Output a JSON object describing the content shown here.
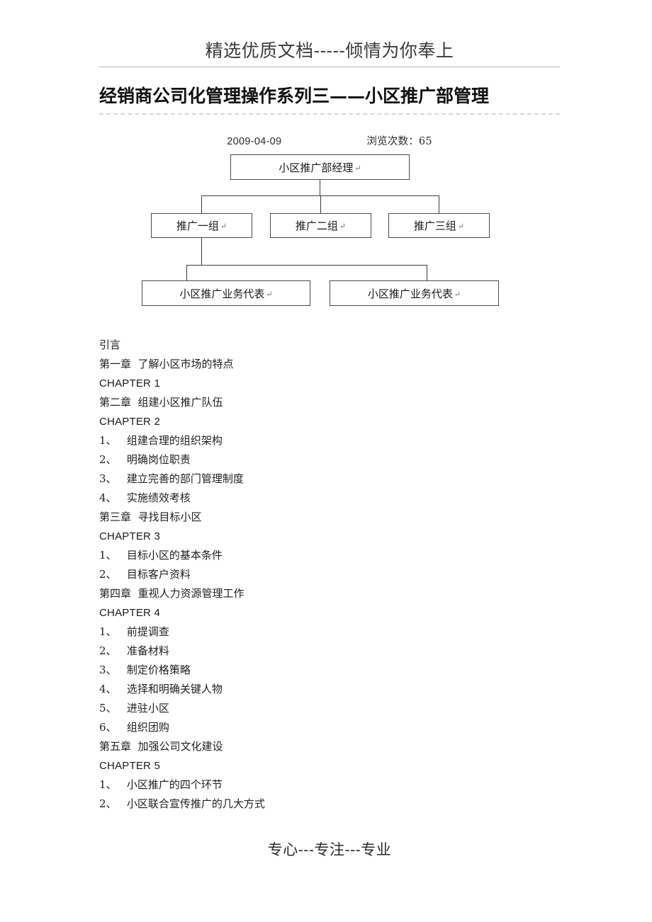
{
  "header": {
    "text": "精选优质文档-----倾情为你奉上"
  },
  "title": "经销商公司化管理操作系列三——小区推广部管理",
  "meta": {
    "date": "2009-04-09",
    "views_label": "浏览次数：65"
  },
  "org_chart": {
    "manager": {
      "label": "小区推广部经理",
      "mark": "↵"
    },
    "groups": [
      {
        "label": "推广一组",
        "mark": "↵"
      },
      {
        "label": "推广二组",
        "mark": "↵"
      },
      {
        "label": "推广三组",
        "mark": "↵"
      }
    ],
    "representatives": [
      {
        "label": "小区推广业务代表",
        "mark": "↵"
      },
      {
        "label": "小区推广业务代表",
        "mark": "↵"
      }
    ]
  },
  "toc": {
    "lines": [
      {
        "text": "引言",
        "style": "cjk"
      },
      {
        "text": "第一章  了解小区市场的特点",
        "style": "cjk"
      },
      {
        "text": "CHAPTER 1",
        "style": "latin"
      },
      {
        "text": "第二章  组建小区推广队伍",
        "style": "cjk"
      },
      {
        "text": "CHAPTER 2",
        "style": "latin"
      },
      {
        "text": "1、   组建合理的组织架构",
        "style": "item"
      },
      {
        "text": "2、   明确岗位职责",
        "style": "item"
      },
      {
        "text": "3、   建立完善的部门管理制度",
        "style": "item"
      },
      {
        "text": "4、   实施绩效考核",
        "style": "item"
      },
      {
        "text": "第三章  寻找目标小区",
        "style": "cjk"
      },
      {
        "text": "CHAPTER 3",
        "style": "latin"
      },
      {
        "text": "1、   目标小区的基本条件",
        "style": "item"
      },
      {
        "text": "2、   目标客户资料",
        "style": "item"
      },
      {
        "text": "第四章  重视人力资源管理工作",
        "style": "cjk"
      },
      {
        "text": "CHAPTER 4",
        "style": "latin"
      },
      {
        "text": "1、   前提调查",
        "style": "item"
      },
      {
        "text": "2、   准备材料",
        "style": "item"
      },
      {
        "text": "3、   制定价格策略",
        "style": "item"
      },
      {
        "text": "4、   选择和明确关键人物",
        "style": "item"
      },
      {
        "text": "5、   进驻小区",
        "style": "item"
      },
      {
        "text": "6、   组织团购",
        "style": "item"
      },
      {
        "text": "第五章  加强公司文化建设",
        "style": "cjk"
      },
      {
        "text": "CHAPTER 5",
        "style": "latin"
      },
      {
        "text": "1、   小区推广的四个环节",
        "style": "item"
      },
      {
        "text": "2、   小区联合宣传推广的几大方式",
        "style": "item"
      }
    ]
  },
  "footer": {
    "text": "专心---专注---专业"
  }
}
